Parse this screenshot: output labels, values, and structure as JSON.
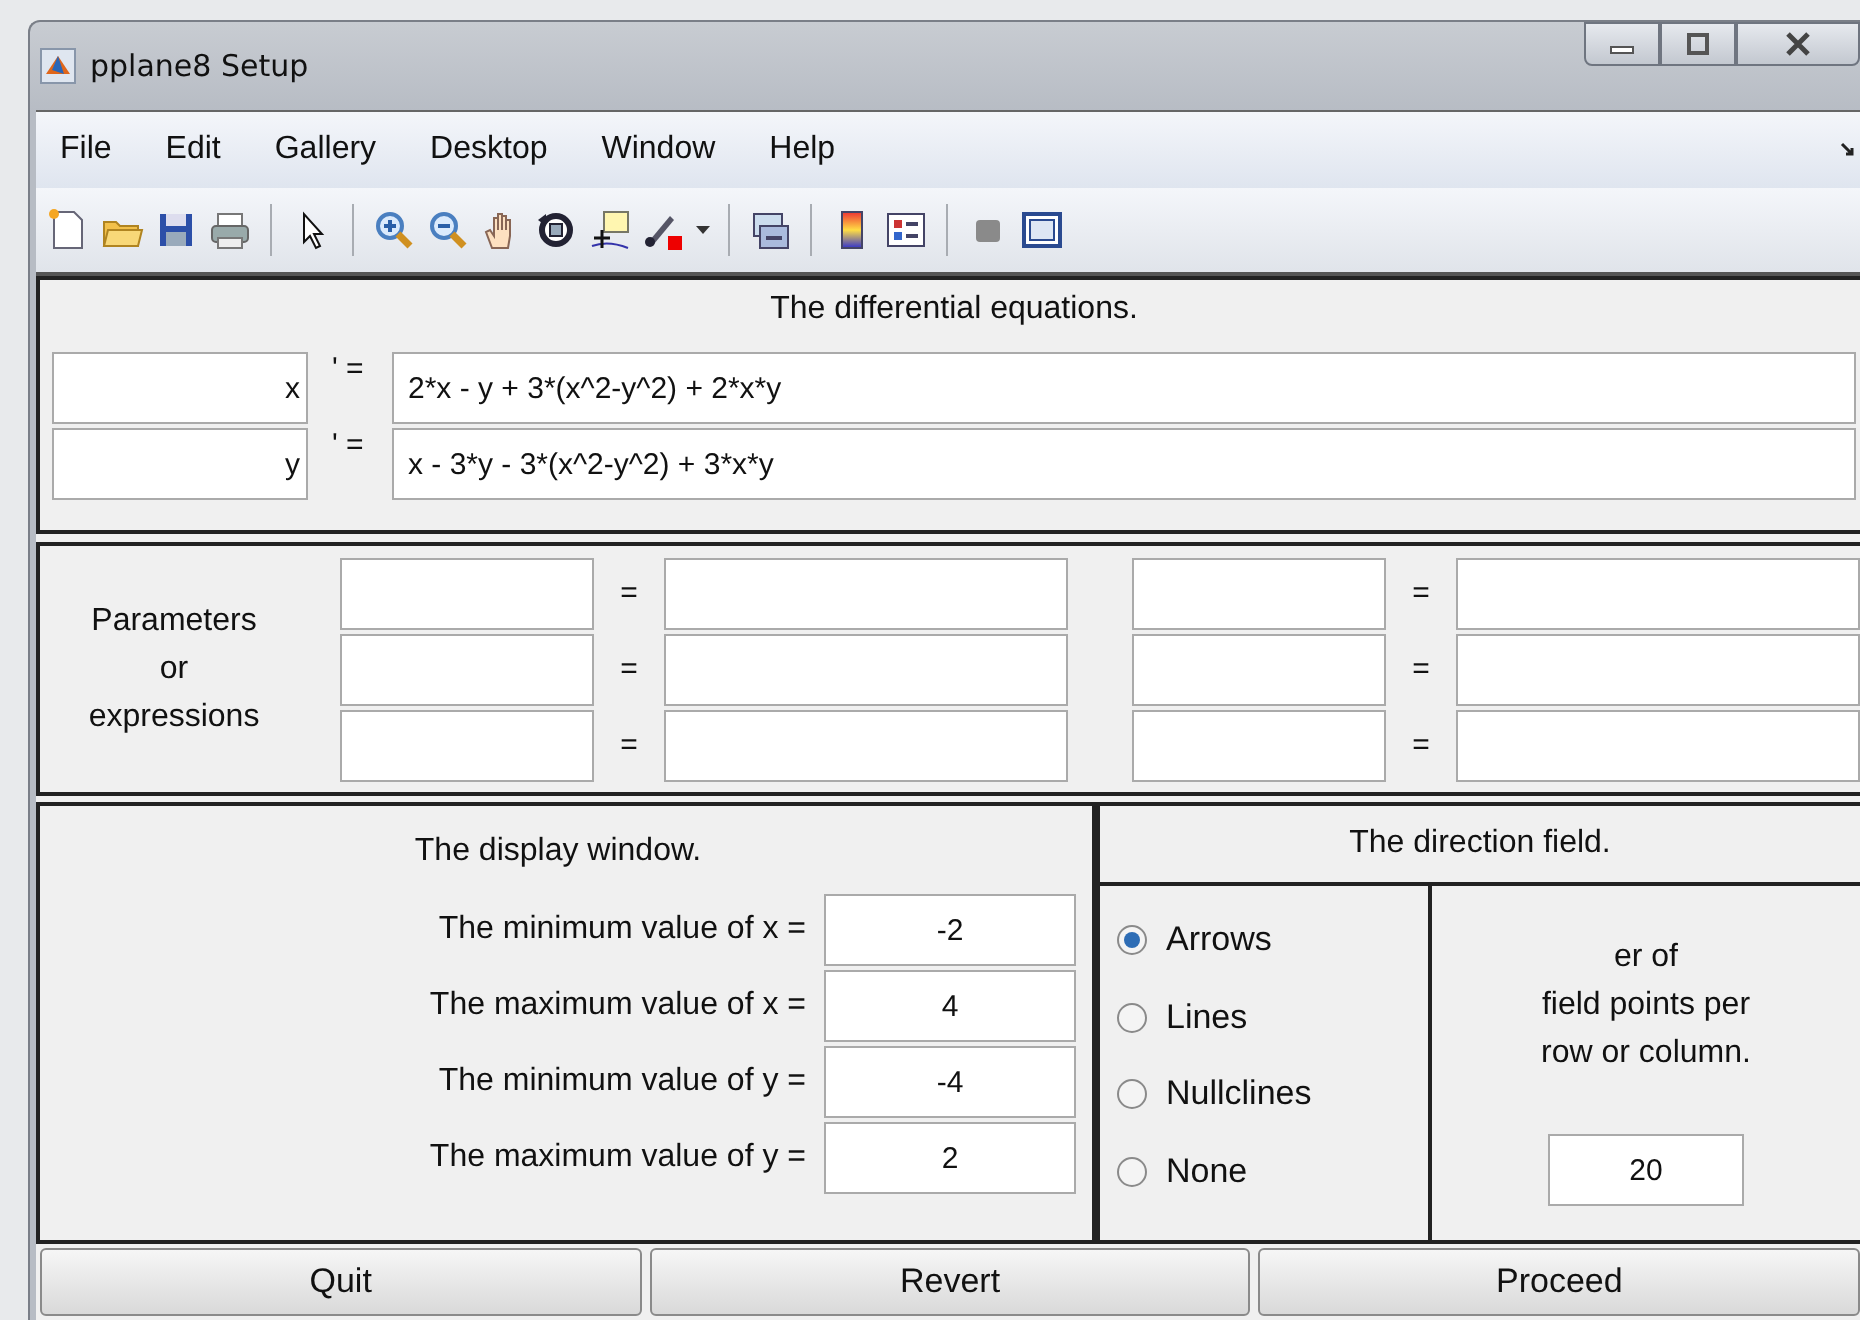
{
  "window": {
    "title": "pplane8 Setup"
  },
  "menu": [
    "File",
    "Edit",
    "Gallery",
    "Desktop",
    "Window",
    "Help"
  ],
  "equations": {
    "title": "The differential equations.",
    "rows": [
      {
        "variable": "x",
        "prime": "' =",
        "expression": "2*x - y + 3*(x^2-y^2) + 2*x*y"
      },
      {
        "variable": "y",
        "prime": "' =",
        "expression": "x - 3*y - 3*(x^2-y^2) + 3*x*y"
      }
    ]
  },
  "parameters": {
    "label": "Parameters\nor\nexpressions",
    "equals": [
      "=",
      "=",
      "=",
      "=",
      "=",
      "="
    ]
  },
  "display_window": {
    "title": "The display window.",
    "rows": [
      {
        "label": "The minimum value of x =",
        "value": "-2"
      },
      {
        "label": "The maximum value of x =",
        "value": "4"
      },
      {
        "label": "The minimum value of y =",
        "value": "-4"
      },
      {
        "label": "The maximum value of y =",
        "value": "2"
      }
    ]
  },
  "direction_field": {
    "title": "The direction field.",
    "options": [
      {
        "label": "Arrows",
        "selected": true
      },
      {
        "label": "Lines",
        "selected": false
      },
      {
        "label": "Nullclines",
        "selected": false
      },
      {
        "label": "None",
        "selected": false
      }
    ],
    "points_label": "er of\nfield points per\nrow or column.",
    "points_value": "20"
  },
  "buttons": [
    "Quit",
    "Revert",
    "Proceed"
  ]
}
